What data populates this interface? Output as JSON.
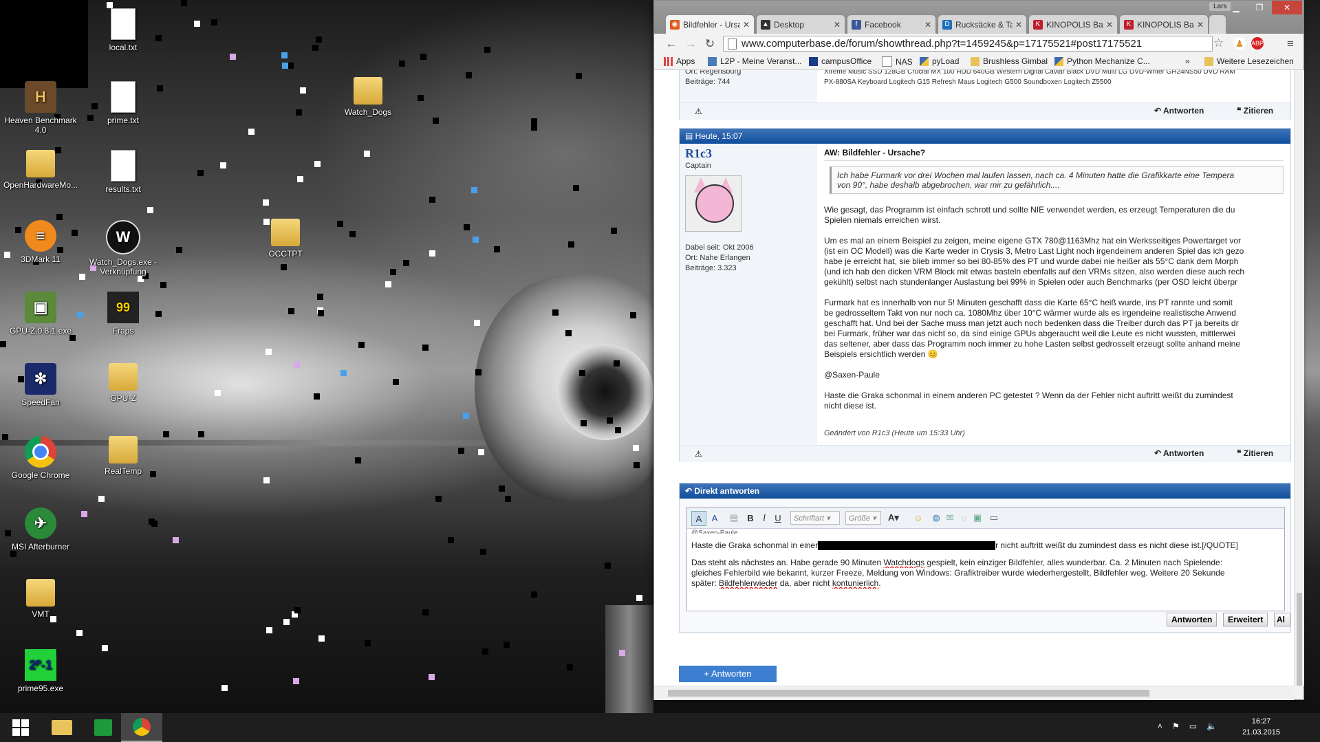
{
  "desktop": {
    "icons": [
      {
        "label": "local.txt",
        "icon": "text-file-icon"
      },
      {
        "label": "Heaven Benchmark 4.0",
        "icon": "heaven-benchmark-icon"
      },
      {
        "label": "prime.txt",
        "icon": "text-file-icon"
      },
      {
        "label": "Watch_Dogs",
        "icon": "folder-icon"
      },
      {
        "label": "OpenHardwareMo...",
        "icon": "folder-icon"
      },
      {
        "label": "results.txt",
        "icon": "text-file-icon"
      },
      {
        "label": "3DMark 11",
        "icon": "3dmark-icon"
      },
      {
        "label": "Watch_Dogs.exe - Verknüpfung",
        "icon": "watch-dogs-icon"
      },
      {
        "label": "OCCTPT",
        "icon": "folder-icon"
      },
      {
        "label": "GPU-Z.0.8.1.exe",
        "icon": "gpuz-icon"
      },
      {
        "label": "Fraps",
        "icon": "fraps-icon"
      },
      {
        "label": "SpeedFan",
        "icon": "speedfan-icon"
      },
      {
        "label": "GPU-Z",
        "icon": "gpuz-folder-icon"
      },
      {
        "label": "Google Chrome",
        "icon": "chrome-icon"
      },
      {
        "label": "RealTemp",
        "icon": "folder-icon"
      },
      {
        "label": "MSI Afterburner",
        "icon": "afterburner-icon"
      },
      {
        "label": "VMT",
        "icon": "folder-icon"
      },
      {
        "label": "prime95.exe",
        "icon": "prime95-icon"
      }
    ]
  },
  "taskbar": {
    "time": "16:27",
    "date": "21.03.2015"
  },
  "browser": {
    "user": "Lars",
    "tabs": [
      {
        "label": "Bildfehler - Ursache?",
        "icon": "computerbase-icon",
        "color": "#e25a1c"
      },
      {
        "label": "Desktop",
        "icon": "desktop-icon",
        "color": "#333333"
      },
      {
        "label": "Facebook",
        "icon": "facebook-icon",
        "color": "#3b5998"
      },
      {
        "label": "Rucksäcke & Taschen",
        "icon": "de-icon",
        "color": "#1d6fbf"
      },
      {
        "label": "KINOPOLIS Bad Godesberg",
        "icon": "kinopolis-icon",
        "color": "#c01d2b"
      },
      {
        "label": "KINOPOLIS Bad Godesberg",
        "icon": "kinopolis-icon",
        "color": "#c01d2b"
      }
    ],
    "url": "www.computerbase.de/forum/showthread.php?t=1459245&p=17175521#post17175521",
    "bookmarks": [
      {
        "label": "Apps",
        "icon": "apps-icon"
      },
      {
        "label": "L2P - Meine Veranst...",
        "icon": "l2p-icon"
      },
      {
        "label": "campusOffice",
        "icon": "campus-icon"
      },
      {
        "label": "NAS",
        "icon": "page-icon"
      },
      {
        "label": "pyLoad",
        "icon": "python-icon"
      },
      {
        "label": "Brushless Gimbal",
        "icon": "folder-icon"
      },
      {
        "label": "Python Mechanize C...",
        "icon": "python-icon"
      },
      {
        "label": "»",
        "icon": "more-icon"
      },
      {
        "label": "Weitere Lesezeichen",
        "icon": "folder-icon"
      }
    ],
    "prev_post": {
      "user_line_1": "Ort: Regensburg",
      "user_line_2": "Beiträge: 744",
      "sig_line_1": "Xtreme Music SSD 128GB Crucial MX 100 HDD 640GB Western Digital Caviar Black DVD Multi LG DVD-Writer GH24NS50 DVD RAM",
      "sig_line_2": "PX-880SA Keyboard Logitech G15 Refresh Maus Logitech G500 Soundboxen Logitech Z5500"
    },
    "actions": {
      "reply": "Antworten",
      "quote": "Zitieren"
    },
    "post": {
      "header": "Heute, 15:07",
      "username": "R1c3",
      "rank": "Captain",
      "joined": "Dabei seit: Okt 2006",
      "location": "Ort: Nahe Erlangen",
      "posts": "Beiträge: 3.323",
      "title": "AW: Bildfehler - Ursache?",
      "quote_1": "Ich habe Furmark vor drei Wochen mal laufen lassen, nach ca. 4 Minuten hatte die Grafikkarte eine Tempera",
      "quote_2": "von 90°, habe deshalb abgebrochen, war mir zu gefährlich....",
      "p1": "Wie gesagt, das Programm ist einfach schrott und sollte NIE verwendet werden, es erzeugt Temperaturen die du\nSpielen niemals erreichen wirst.",
      "p2": "Um es mal an einem Beispiel zu zeigen, meine eigene GTX 780@1163Mhz hat ein Werksseitiges Powertarget vor\n(ist ein OC Modell) was die Karte weder in Crysis 3, Metro Last Light noch irgendeinem anderen Spiel das ich gezo\nhabe je erreicht hat, sie blieb immer so bei 80-85% des PT und wurde dabei nie heißer als 55°C dank dem Morph\n(und ich hab den dicken VRM Block mit etwas basteln ebenfalls auf den VRMs sitzen, also werden diese auch rech\ngekühlt) selbst nach stundenlanger Auslastung bei 99% in Spielen oder auch Benchmarks (per OSD leicht überpr",
      "p3": "Furmark hat es innerhalb von nur 5! Minuten geschafft dass die Karte 65°C heiß wurde, ins PT rannte und somit\nbe gedrosseltem Takt von nur noch ca. 1080Mhz über 10°C wärmer wurde als es irgendeine realistische Anwend\ngeschafft hat. Und bei der Sache muss man jetzt auch noch bedenken dass die Treiber durch das PT ja bereits dr\nbei Furmark, früher war das nicht so, da sind einige GPUs abgeraucht weil die Leute es nicht wussten, mittlerwei\ndas seltener, aber dass das Programm noch immer zu hohe Lasten selbst gedrosselt erzeugt sollte anhand meine\nBeispiels ersichtlich werden 😊",
      "p4": "@Saxen-Paule",
      "p5": "Haste die Graka schonmal in einem anderen PC getestet ? Wenn da der Fehler nicht auftritt weißt du zumindest\nnicht diese ist.",
      "edited": "Geändert von R1c3 (Heute um 15:33 Uhr)"
    },
    "reply": {
      "header": "Direkt antworten",
      "font_placeholder": "Schriftart",
      "size_placeholder": "Größe",
      "line_0": "@Saxen-Paule",
      "line_1a": "Haste die Graka schonmal in einer",
      "line_1b": "r nicht auftritt weißt du zumindest dass es nicht diese ist.[/QUOTE]",
      "line_2a": "Das steht als nächstes an. Habe gerade 90 Minuten ",
      "line_2b": "Watchdogs",
      "line_2c": " gespielt, kein einziger Bildfehler, alles wunderbar. Ca. 2 Minuten nach Spielende:",
      "line_3": "gleiches Fehlerbild wie bekannt, kurzer Freeze, Meldung von Windows: Grafiktreiber wurde wiederhergestellt, Bildfehler weg. Weitere 20 Sekunde",
      "line_4a": "später: ",
      "line_4b": "Bildfehlerwieder",
      "line_4c": " da, aber nicht ",
      "line_4d": "kontunierlich",
      "line_4e": ".",
      "btn_reply": "Antworten",
      "btn_advanced": "Erweitert",
      "btn_cut": "Al"
    },
    "answer_button": "+ Antworten"
  }
}
